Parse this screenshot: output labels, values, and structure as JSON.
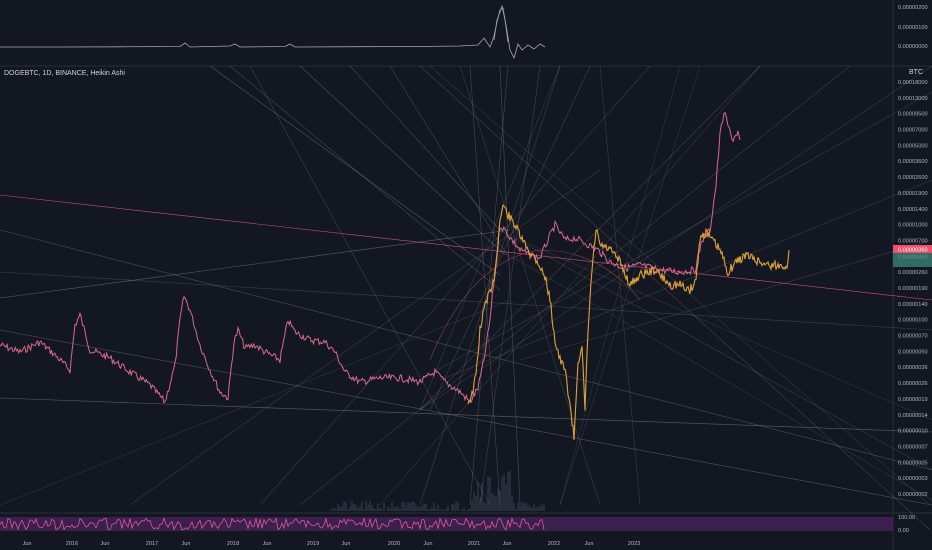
{
  "header": {
    "symbol_label": "DOGEBTC, 1D, BINANCE, Heikin Ashi",
    "currency": "BTC"
  },
  "colors": {
    "background": "#131722",
    "price_line": "#d96a8c",
    "overlay_line": "#e0a33a",
    "trendline_gray": "#8a8e98",
    "trendline_pink": "#e05577",
    "price_badge": "#f0506e",
    "oscillator_fill": "#5b2775"
  },
  "top_panel": {
    "ticks": [
      "0.00000200",
      "0.00000100",
      "0.00000000"
    ]
  },
  "main_axis": {
    "scale": "log",
    "ticks": [
      "0.00018000",
      "0.00013000",
      "0.00009500",
      "0.00007000",
      "0.00005000",
      "0.00003600",
      "0.00002600",
      "0.00001900",
      "0.00001400",
      "0.00001000",
      "0.00000700",
      "0.00000360",
      "0.00000260",
      "0.00000190",
      "0.00000140",
      "0.00000100",
      "0.00000070",
      "0.00000050",
      "0.00000036",
      "0.00000026",
      "0.00000019",
      "0.00000014",
      "0.00000010",
      "0.00000007",
      "0.00000005",
      "0.00000003",
      "0.00000002"
    ],
    "last_price_badge": "0.00000360"
  },
  "bottom_panel": {
    "ticks": [
      "100.00",
      "0.00"
    ]
  },
  "x_axis": {
    "labels": [
      "Jun",
      "2016",
      "Jun",
      "2017",
      "Jun",
      "2018",
      "Jun",
      "2019",
      "Jun",
      "2020",
      "Jun",
      "2021",
      "Jun",
      "2022",
      "Jun",
      "2023"
    ]
  },
  "chart_data": {
    "type": "line",
    "symbol": "DOGEBTC, 1D, BINANCE, Heikin Ashi",
    "y_scale": "log",
    "ylim": [
      2e-08,
      0.00018
    ],
    "x": [
      "Jun",
      "2016",
      "Jun",
      "2017",
      "Jun",
      "2018",
      "Jun",
      "2019",
      "Jun",
      "2020",
      "Jun",
      "2021",
      "Jun",
      "2022",
      "Jun",
      "2023"
    ],
    "series": [
      {
        "color": "#d96a8c",
        "values": [
          3e-07,
          4e-07,
          2.8e-07,
          2e-07,
          1.2e-06,
          2e-07,
          7e-07,
          2.8e-07,
          6e-07,
          3.2e-07,
          2.4e-07,
          3.5e-06,
          2.5e-06,
          1.4e-06,
          2e-06,
          8e-06
        ]
      },
      {
        "color": "#e0a33a",
        "values": [
          null,
          null,
          null,
          null,
          null,
          null,
          null,
          null,
          null,
          null,
          3e-07,
          2e-06,
          1.2e-06,
          8e-08,
          1.2e-06,
          2.2e-06
        ]
      }
    ]
  }
}
